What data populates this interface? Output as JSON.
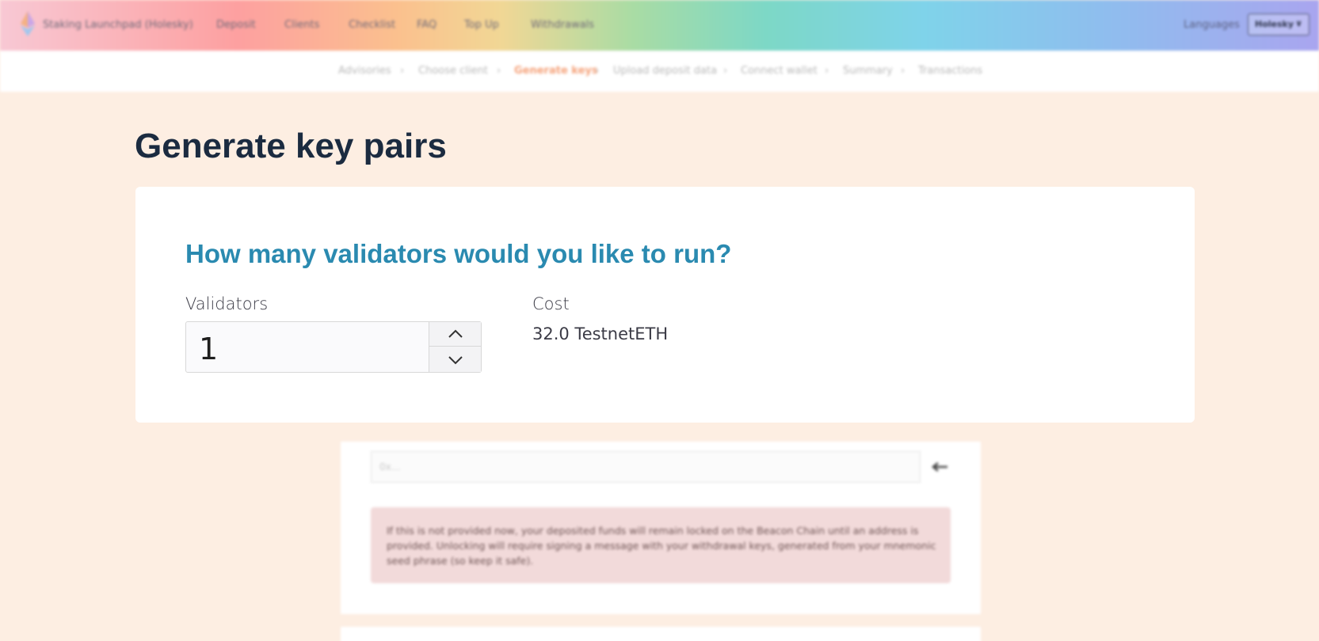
{
  "topbar": {
    "brand": "Staking Launchpad (Holesky)",
    "nav": [
      "Deposit",
      "Clients",
      "Checklist",
      "FAQ",
      "Top Up",
      "Withdrawals"
    ],
    "languages": "Languages",
    "network": "Holesky"
  },
  "steps": {
    "items": [
      "Advisories",
      "Choose client",
      "Generate keys",
      "Upload deposit data",
      "Connect wallet",
      "Summary",
      "Transactions"
    ],
    "active": "Generate keys"
  },
  "page": {
    "title": "Generate key pairs"
  },
  "validator_card": {
    "question": "How many validators would you like to run?",
    "validators_label": "Validators",
    "validators_value": "1",
    "cost_label": "Cost",
    "cost_value": "32.0 TestnetETH"
  },
  "withdrawal": {
    "address_placeholder": "0x...",
    "warning": "If this is not provided now, your deposited funds will remain locked on the Beacon Chain until an address is provided. Unlocking will require signing a message with your withdrawal keys, generated from your mnemonic seed phrase (so keep it safe)."
  },
  "colors": {
    "background": "#fdeee2",
    "heading": "#1b2b40",
    "question": "#2a8ab0",
    "active_step": "#f5a27a",
    "warning_bg": "#f2dada"
  }
}
